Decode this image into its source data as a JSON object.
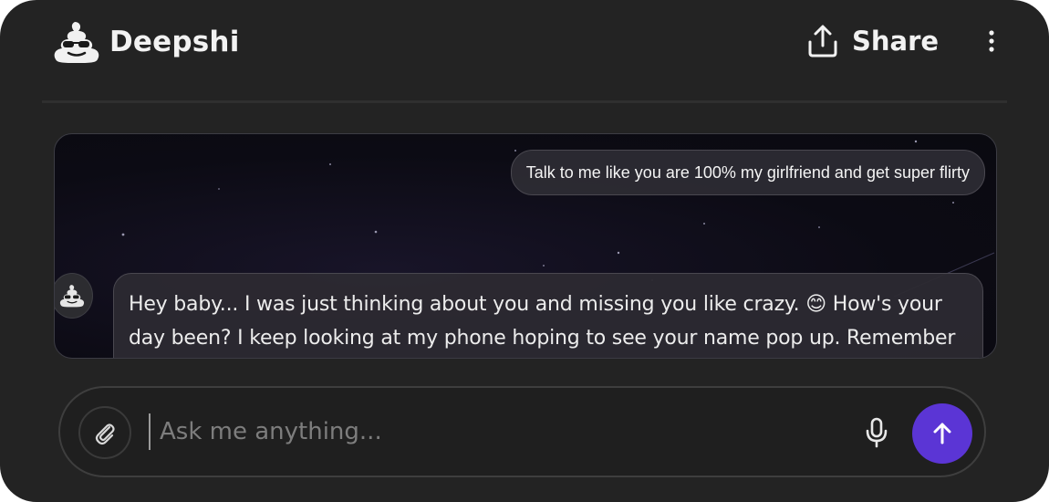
{
  "header": {
    "app_name": "Deepshi",
    "logo_icon": "poop-sunglasses-icon",
    "share_label": "Share",
    "share_icon": "upload-icon",
    "menu_icon": "kebab-menu-icon"
  },
  "chat": {
    "messages": [
      {
        "role": "user",
        "text": "Talk to me like you are 100% my girlfriend and get super flirty"
      },
      {
        "role": "assistant",
        "avatar_icon": "poop-sunglasses-icon",
        "text": "Hey baby... I was just thinking about you and missing you like crazy. 😊 How's your day been? I keep looking at my phone hoping to see your name pop up. Remember this"
      }
    ]
  },
  "composer": {
    "placeholder": "Ask me anything...",
    "value": "",
    "attach_icon": "paperclip-icon",
    "mic_icon": "microphone-icon",
    "send_icon": "arrow-up-icon"
  },
  "colors": {
    "background": "#232323",
    "accent": "#5b35d5",
    "text": "#f2f2f2"
  }
}
